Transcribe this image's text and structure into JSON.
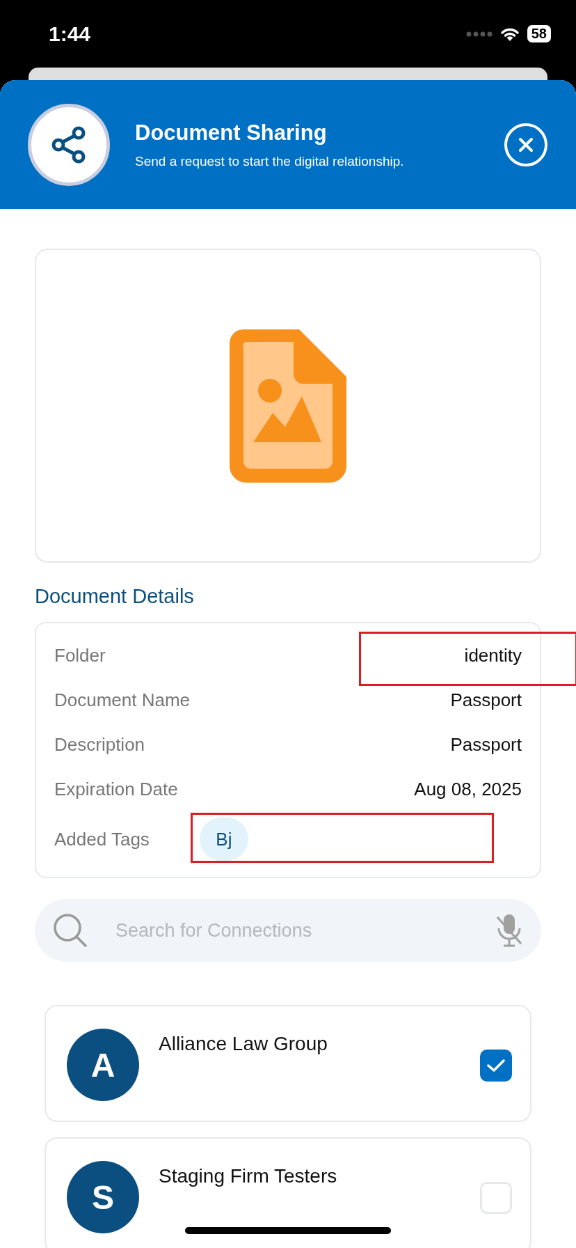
{
  "status_bar": {
    "time": "1:44",
    "battery": "58"
  },
  "header": {
    "title": "Document Sharing",
    "subtitle": "Send a request to start the digital relationship."
  },
  "details": {
    "heading": "Document Details",
    "rows": [
      {
        "kind": "text",
        "label": "Folder",
        "value": "identity",
        "highlighted": true
      },
      {
        "kind": "text",
        "label": "Document Name",
        "value": "Passport",
        "highlighted": false
      },
      {
        "kind": "text",
        "label": "Description",
        "value": "Passport",
        "highlighted": false
      },
      {
        "kind": "text",
        "label": "Expiration Date",
        "value": "Aug 08, 2025",
        "highlighted": false
      },
      {
        "kind": "tags",
        "label": "Added Tags",
        "tags": [
          "Bj"
        ],
        "highlighted": true
      }
    ]
  },
  "search": {
    "placeholder": "Search for Connections"
  },
  "connections": [
    {
      "initial": "A",
      "name": "Alliance Law Group",
      "checked": true
    },
    {
      "initial": "S",
      "name": "Staging Firm Testers",
      "checked": false
    }
  ]
}
